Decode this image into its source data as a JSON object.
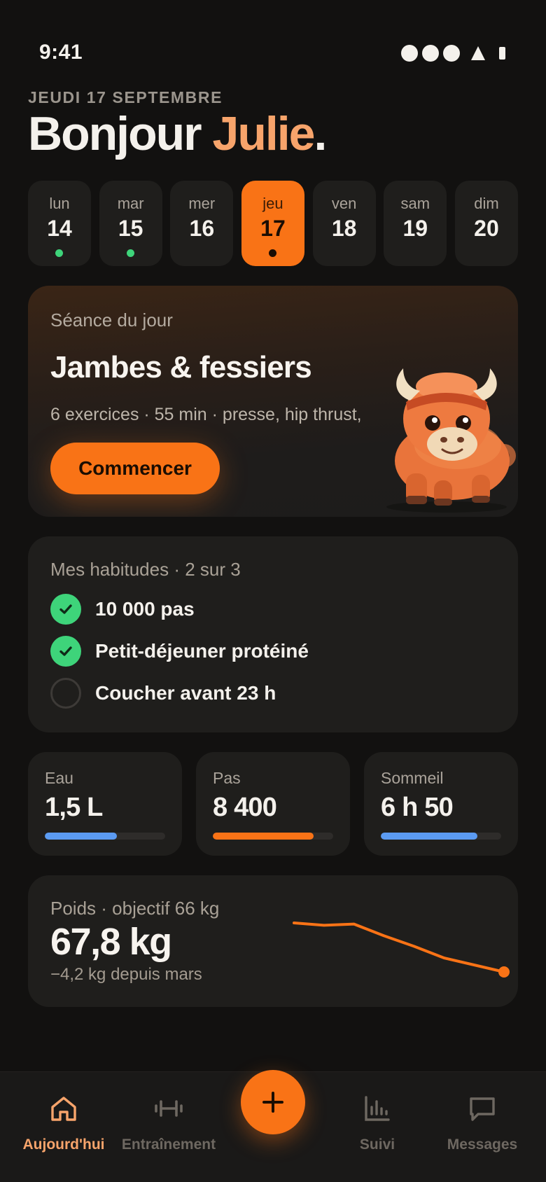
{
  "status_bar": {
    "time": "9:41"
  },
  "header": {
    "date": "JEUDI 17 SEPTEMBRE",
    "greeting_prefix": "Bonjour ",
    "user_name": "Julie",
    "greeting_suffix": "."
  },
  "week": [
    {
      "day": "lun",
      "num": "14",
      "dot": "green"
    },
    {
      "day": "mar",
      "num": "15",
      "dot": "green"
    },
    {
      "day": "mer",
      "num": "16",
      "dot": "none"
    },
    {
      "day": "jeu",
      "num": "17",
      "dot": "dark",
      "selected": true
    },
    {
      "day": "ven",
      "num": "18",
      "dot": "none"
    },
    {
      "day": "sam",
      "num": "19",
      "dot": "none"
    },
    {
      "day": "dim",
      "num": "20",
      "dot": "none"
    }
  ],
  "session": {
    "label": "Séance du jour",
    "title": "Jambes & fessiers",
    "description": "6 exercices · 55 min · presse, hip thrust,",
    "cta": "Commencer",
    "mascot_icon": "bison-mascot"
  },
  "habits": {
    "header": "Mes habitudes · 2 sur 3",
    "items": [
      {
        "label": "10 000 pas",
        "done": true
      },
      {
        "label": "Petit-déjeuner protéiné",
        "done": true
      },
      {
        "label": "Coucher avant 23 h",
        "done": false
      }
    ]
  },
  "stats": [
    {
      "label": "Eau",
      "value": "1,5 L",
      "progress": 0.6,
      "color": "#5b9bf2"
    },
    {
      "label": "Pas",
      "value": "8 400",
      "progress": 0.84,
      "color": "#f97316"
    },
    {
      "label": "Sommeil",
      "value": "6 h 50",
      "progress": 0.8,
      "color": "#5b9bf2"
    }
  ],
  "weight": {
    "label": "Poids · objectif 66 kg",
    "value": "67,8 kg",
    "delta": "−4,2 kg depuis mars",
    "trend": [
      72.0,
      71.8,
      71.9,
      70.9,
      70.0,
      69.0,
      68.4,
      67.8
    ],
    "color": "#f97316"
  },
  "tabbar": {
    "items": [
      {
        "label": "Aujourd'hui",
        "icon": "home-icon",
        "active": true
      },
      {
        "label": "Entraînement",
        "icon": "dumbbell-icon",
        "active": false
      },
      {
        "label": "Suivi",
        "icon": "chart-icon",
        "active": false
      },
      {
        "label": "Messages",
        "icon": "message-icon",
        "active": false
      }
    ],
    "fab_icon": "plus-icon"
  },
  "colors": {
    "accent": "#f97316",
    "accent_light": "#f7a46b",
    "success": "#3ed47a",
    "background": "#121110",
    "card": "#1f1e1c"
  }
}
